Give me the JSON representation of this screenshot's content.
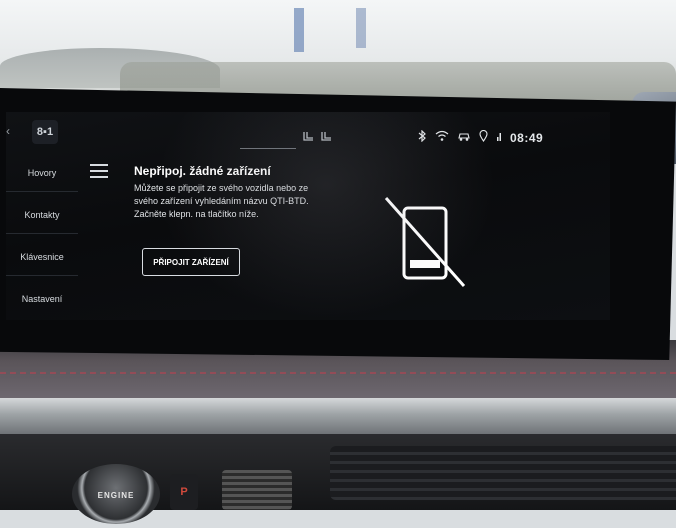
{
  "status_bar": {
    "app_icon_label": "8▪1",
    "time": "08:49",
    "icons": [
      "bluetooth-icon",
      "wifi-icon",
      "car-icon",
      "location-icon",
      "signal-icon"
    ]
  },
  "sidebar": {
    "items": [
      {
        "label": "Hovory"
      },
      {
        "label": "Kontakty"
      },
      {
        "label": "Klávesnice"
      },
      {
        "label": "Nastavení"
      }
    ]
  },
  "main": {
    "title": "Nepřipoj. žádné zařízení",
    "body": "Můžete se připojit ze svého vozidla nebo ze svého zařízení vyhledáním názvu QTI-BTD. Začněte klepn. na tlačítko níže.",
    "connect_button": "PŘIPOJIT ZAŘÍZENÍ"
  },
  "car": {
    "engine_label": "ENGINE",
    "gear_label": "P"
  },
  "colors": {
    "screen_bg": "#0a0b0d",
    "text": "#ffffff",
    "gear_p": "#d14a3c"
  }
}
